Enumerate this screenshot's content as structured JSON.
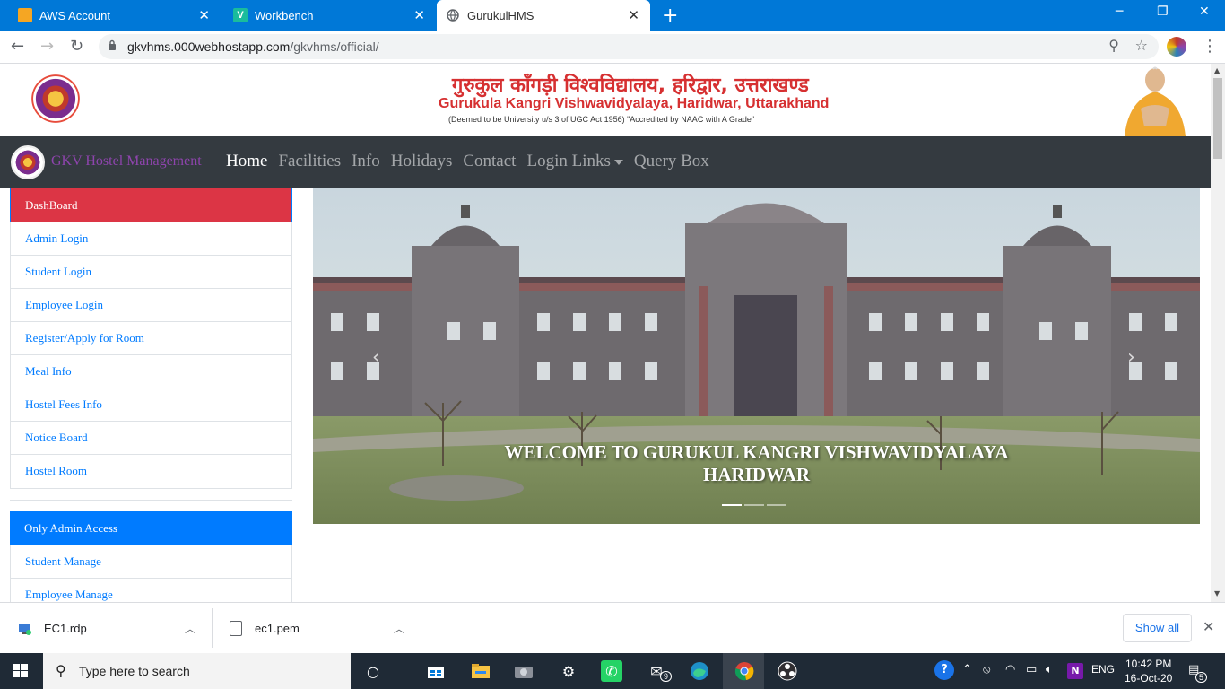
{
  "browser": {
    "tabs": [
      {
        "title": "AWS Account",
        "icon": "aws-icon"
      },
      {
        "title": "Workbench",
        "icon": "v-logo-icon"
      },
      {
        "title": "GurukulHMS",
        "icon": "globe-icon",
        "active": true
      }
    ],
    "url_host": "gkvhms.000webhostapp.com",
    "url_path": "/gkvhms/official/"
  },
  "header": {
    "hindi_title": "गुरुकुल काँगड़ी विश्वविद्यालय, हरिद्वार, उत्तराखण्ड",
    "english_title": "Gurukula Kangri Vishwavidyalaya, Haridwar, Uttarakhand",
    "subtitle": "(Deemed to be University u/s 3 of UGC Act 1956) \"Accredited by NAAC with A Grade\""
  },
  "navbar": {
    "brand": "GKV Hostel Management",
    "links": [
      "Home",
      "Facilities",
      "Info",
      "Holidays",
      "Contact",
      "Login Links",
      "Query Box"
    ],
    "active": "Home"
  },
  "sidebar": {
    "dashboard_title": "DashBoard",
    "dashboard_items": [
      "Admin Login",
      "Student Login",
      "Employee Login",
      "Register/Apply for Room",
      "Meal Info",
      "Hostel Fees Info",
      "Notice Board",
      "Hostel Room"
    ],
    "admin_title": "Only Admin Access",
    "admin_items": [
      "Student Manage",
      "Employee Manage"
    ]
  },
  "carousel": {
    "caption_line1": "WELCOME TO GURUKUL KANGRI VISHWAVIDYALAYA",
    "caption_line2": "HARIDWAR",
    "prev": "‹",
    "next": "›",
    "slides": 3,
    "active_slide": 1
  },
  "downloads": {
    "files": [
      "EC1.rdp",
      "ec1.pem"
    ],
    "show_all": "Show all"
  },
  "taskbar": {
    "search_placeholder": "Type here to search",
    "time": "10:42 PM",
    "date": "16-Oct-20",
    "language": "ENG",
    "mail_badge": "9",
    "notification_badge": "5"
  },
  "colors": {
    "tabbar": "#0078d7",
    "navbar": "#343a40",
    "brand": "#8e44ad",
    "dashboard_header": "#dc3545",
    "admin_header": "#007bff",
    "link": "#007bff",
    "title_red": "#d63031"
  }
}
